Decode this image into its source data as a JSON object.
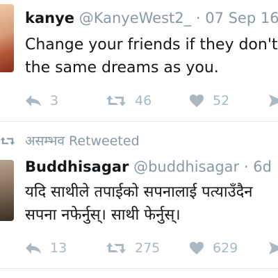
{
  "tweets": [
    {
      "display_name": "kanye",
      "handle": "@KanyeWest2_",
      "separator": "·",
      "date": "07 Sep 16",
      "lines": [
        "Change your friends if they don't",
        "the same dreams as you."
      ],
      "actions": {
        "reply_count": "3",
        "retweet_count": "46",
        "like_count": "52"
      }
    },
    {
      "retweeted_by": "असम्भव",
      "retweeted_label": "Retweeted",
      "display_name": "Buddhisagar",
      "handle": "@buddhisagar",
      "separator": "·",
      "date": "6d",
      "lines": [
        "यदि साथीले तपाईको सपनालाई पत्याउँदैन",
        "सपना नफेर्नुस्। साथी फेर्नुस्।"
      ],
      "actions": {
        "reply_count": "13",
        "retweet_count": "275",
        "like_count": "629"
      }
    }
  ],
  "icons": {
    "reply": "reply-arrow-icon",
    "retweet": "retweet-arrows-icon",
    "like": "heart-icon",
    "share": "direct-message-icon"
  },
  "colors": {
    "icon_gray": "#aab8c2",
    "meta_gray": "#8899a6",
    "divider": "#e1e8ed"
  }
}
